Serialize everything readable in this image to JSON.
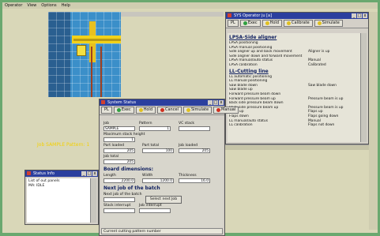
{
  "menubar": {
    "items": [
      "Operator",
      "View",
      "Options",
      "Help"
    ]
  },
  "job_label": "Job SAMPLE Pattern: 1",
  "sys_window": {
    "title": "SYS  Operator ju [a]",
    "toolbar": [
      "PL",
      "Exec",
      "Hold",
      "Calibrate",
      "Simulate"
    ],
    "sections": [
      {
        "header": "LPSA-Side aligner",
        "rows": [
          {
            "l": "LPSA positioning",
            "r": ""
          },
          {
            "l": "LPSA manual positioning",
            "r": ""
          },
          {
            "l": "Side aligner up and back movement",
            "r": "Aligner is up"
          },
          {
            "l": "Side aligner down and forward movement",
            "r": ""
          },
          {
            "l": "LPSA manual/auto status",
            "r": "Manual"
          },
          {
            "l": "LPSA calibration",
            "r": "Calibrated"
          }
        ]
      },
      {
        "header": "LL-Cutting line",
        "rows": [
          {
            "l": "LL automatic positioning",
            "r": ""
          },
          {
            "l": "LL manual positioning",
            "r": ""
          },
          {
            "l": "Saw blade down",
            "r": "Saw blade down"
          },
          {
            "l": "Saw blade up",
            "r": ""
          },
          {
            "l": "Forward pressure beam down",
            "r": ""
          },
          {
            "l": "Forward pressure beam up",
            "r": "Pressure beam is up"
          },
          {
            "l": "Back side pressure beam down",
            "r": ""
          },
          {
            "l": "Back side pressure beam up",
            "r": "Pressure beam is up"
          },
          {
            "l": "Flaps up",
            "r": "Flaps up"
          },
          {
            "l": "Flaps down",
            "r": "Flaps going down"
          },
          {
            "l": "LL manual/auto status",
            "r": "Manual"
          },
          {
            "l": "LL calibration",
            "r": "Flaps not down"
          }
        ]
      }
    ]
  },
  "status_window": {
    "title": "System Status",
    "toolbar": [
      "PL",
      "Exec",
      "Hold",
      "Cancel",
      "Simulate",
      "Manual"
    ],
    "job_label": "Job",
    "job_value": "SAMPLE",
    "pattern_label": "Pattern",
    "pattern_value": "1",
    "vc_stack_label": "VC stack",
    "vc_stack_value": "",
    "max_height_label": "Maximum stack height",
    "max_height_value": "1",
    "part_loaded_label": "Part loaded",
    "part_loaded_value": "205",
    "part_total_label": "Part total",
    "part_total_value": "100",
    "job_loaded_label": "Job loaded",
    "job_loaded_value": "205",
    "job_total_label": "Job total",
    "job_total_value": "205",
    "board_header": "Board dimensions:",
    "length_label": "Length",
    "length_value": "2200.0",
    "width_label": "Width",
    "width_value": "1200.0",
    "thickness_label": "Thickness",
    "thickness_value": "16.0",
    "next_header": "Next job of the batch",
    "next_job_label": "Next job of the batch",
    "select_next_job": "Select next Job",
    "stack_interrupt": "Stack interrupt",
    "job_interrupt": "Job interrupt",
    "status_line": "Current cutting pattern number"
  },
  "small_window": {
    "title": "Status Info",
    "lines": [
      "List of out panels",
      "MA: IDLE"
    ]
  },
  "colors": {
    "titlebar": "#2b3f9e",
    "background": "#6aa86f",
    "accent_yellow": "#f4d000"
  }
}
